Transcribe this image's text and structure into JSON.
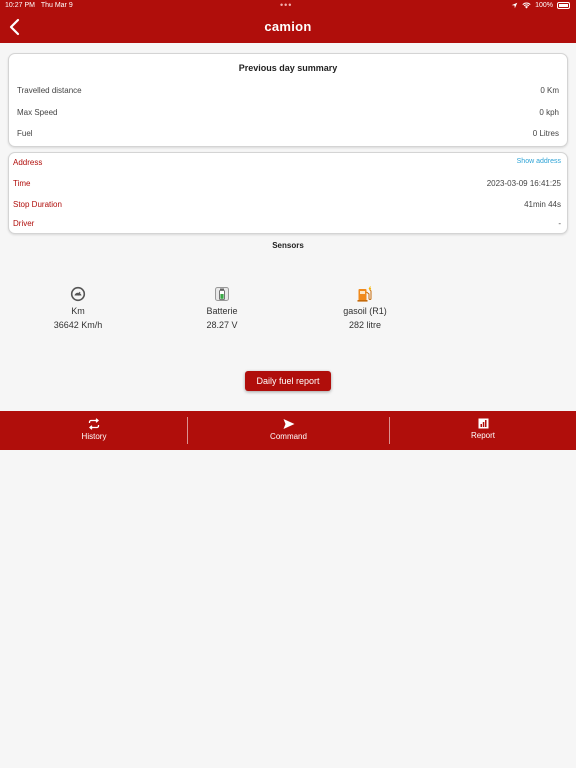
{
  "status_bar": {
    "time": "10:27 PM",
    "date": "Thu Mar 9",
    "battery": "100%",
    "dots": "•••"
  },
  "header": {
    "title": "camion",
    "back_icon": "chevron-left-icon"
  },
  "summary": {
    "title": "Previous day summary",
    "rows": [
      {
        "label": "Travelled distance",
        "value": "0 Km"
      },
      {
        "label": "Max Speed",
        "value": "0 kph"
      },
      {
        "label": "Fuel",
        "value": "0 Litres"
      }
    ]
  },
  "details": {
    "address_label": "Address",
    "address_link": "Show address",
    "time_label": "Time",
    "time_value": "2023-03-09 16:41:25",
    "stop_label": "Stop Duration",
    "stop_value": "41min 44s",
    "driver_label": "Driver",
    "driver_value": "-"
  },
  "sensors": {
    "title": "Sensors",
    "items": [
      {
        "label": "Km",
        "value": "36642 Km/h",
        "icon": "speedometer-icon"
      },
      {
        "label": "Batterie",
        "value": "28.27 V",
        "icon": "battery-icon"
      },
      {
        "label": "gasoil (R1)",
        "value": "282 litre",
        "icon": "fuel-pump-icon"
      }
    ]
  },
  "fuel_report_button": "Daily fuel report",
  "tabs": [
    {
      "label": "History",
      "icon": "repeat-icon"
    },
    {
      "label": "Command",
      "icon": "send-icon"
    },
    {
      "label": "Report",
      "icon": "bar-chart-icon"
    }
  ],
  "colors": {
    "primary": "#b00e0b",
    "link": "#2ea3d6",
    "background": "#f6f6f6"
  }
}
